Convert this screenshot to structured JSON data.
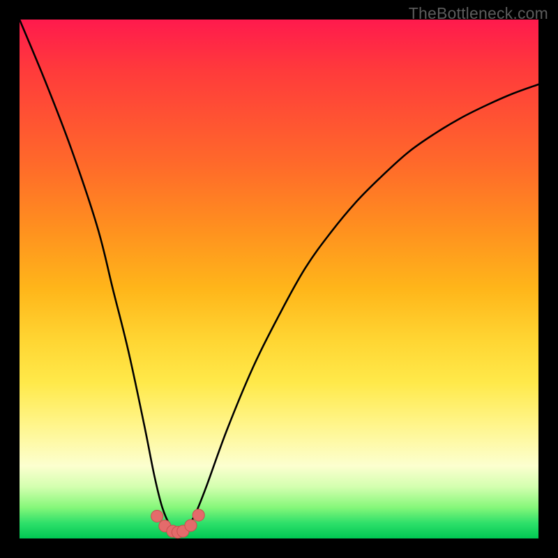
{
  "watermark": {
    "text": "TheBottleneck.com"
  },
  "colors": {
    "curve_stroke": "#000000",
    "marker_fill": "#e46b6b",
    "marker_stroke": "#c94f4f"
  },
  "chart_data": {
    "type": "line",
    "title": "",
    "xlabel": "",
    "ylabel": "",
    "xlim": [
      0,
      100
    ],
    "ylim": [
      0,
      100
    ],
    "grid": false,
    "series": [
      {
        "name": "bottleneck-curve",
        "x": [
          0,
          5,
          10,
          15,
          18,
          21,
          24,
          26,
          27.5,
          29,
          30,
          31,
          32.5,
          34,
          36,
          40,
          45,
          50,
          55,
          60,
          65,
          70,
          75,
          80,
          85,
          90,
          95,
          100
        ],
        "values": [
          100,
          88,
          75,
          60,
          48,
          36,
          22,
          12,
          6,
          2.5,
          1.5,
          1.5,
          2.5,
          5,
          10,
          21,
          33,
          43,
          52,
          59,
          65,
          70,
          74.5,
          78,
          81,
          83.5,
          85.7,
          87.5
        ]
      }
    ],
    "markers": {
      "name": "valley-markers",
      "x": [
        26.5,
        28,
        29.5,
        30.5,
        31.5,
        33,
        34.5
      ],
      "values": [
        4.3,
        2.4,
        1.4,
        1.2,
        1.4,
        2.5,
        4.5
      ],
      "radius_pct": 1.15
    }
  }
}
